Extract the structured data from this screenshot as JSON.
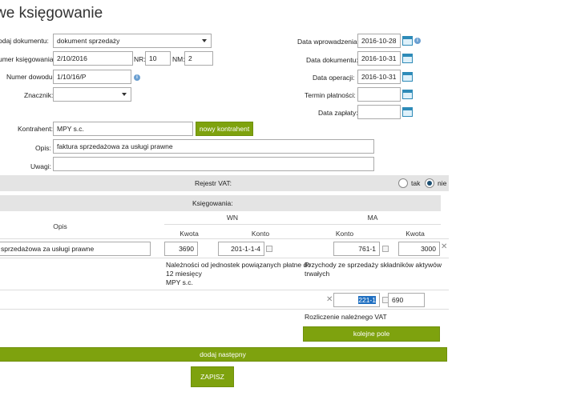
{
  "page": {
    "title": "we księgowanie"
  },
  "form": {
    "doc_type_label": "odaj dokumentu:",
    "doc_type_value": "dokument sprzedaży",
    "accounting_no_label": "umer księgowania:",
    "accounting_no_value": "2/10/2016",
    "nr_label": "NR:",
    "nr_value": "10",
    "nm_label": "NM:",
    "nm_value": "2",
    "proof_no_label": "Numer dowodu:",
    "proof_no_value": "1/10/16/P",
    "marker_label": "Znacznik:",
    "marker_value": "",
    "entry_date_label": "Data wprowadzenia:",
    "entry_date_value": "2016-10-28",
    "doc_date_label": "Data dokumentu:",
    "doc_date_value": "2016-10-31",
    "op_date_label": "Data operacji:",
    "op_date_value": "2016-10-31",
    "due_date_label": "Termin płatności:",
    "due_date_value": "",
    "pay_date_label": "Data zapłaty:",
    "pay_date_value": "",
    "contractor_label": "Kontrahent:",
    "contractor_value": "MPY s.c.",
    "new_contractor_button": "nowy kontrahent",
    "desc_label": "Opis:",
    "desc_value": "faktura sprzedażowa za usługi prawne",
    "notes_label": "Uwagi:",
    "notes_value": ""
  },
  "vat": {
    "label": "Rejestr VAT:",
    "yes_label": "tak",
    "no_label": "nie",
    "selected": "nie"
  },
  "bookings": {
    "label": "Księgowania:",
    "col_opis": "Opis",
    "col_wn": "WN",
    "col_ma": "MA",
    "col_kwota": "Kwota",
    "col_konto": "Konto",
    "row_desc": "sprzedażowa za usługi prawne",
    "wn_amount": "3690",
    "wn_account": "201-1-1-4",
    "ma_account": "761-1",
    "ma_amount": "3000",
    "wn_account_desc_1": "Należności od jednostek powiązanych płatne do",
    "wn_account_desc_2": "12 miesięcy",
    "wn_account_desc_3": "MPY s.c.",
    "ma_account_desc_1": "Przychody ze sprzedaży składników aktywów",
    "ma_account_desc_2": "trwałych",
    "ma2_account": "221-1",
    "ma2_amount": "690",
    "ma2_account_desc": "Rozliczenie należnego VAT",
    "next_field_button": "kolejne pole",
    "add_next_button": "dodaj następny",
    "save_button": "ZAPISZ"
  },
  "colors": {
    "accent_green": "#7ea20e",
    "bar_gray": "#e4e4e4",
    "selection_blue": "#1f6fc1"
  }
}
